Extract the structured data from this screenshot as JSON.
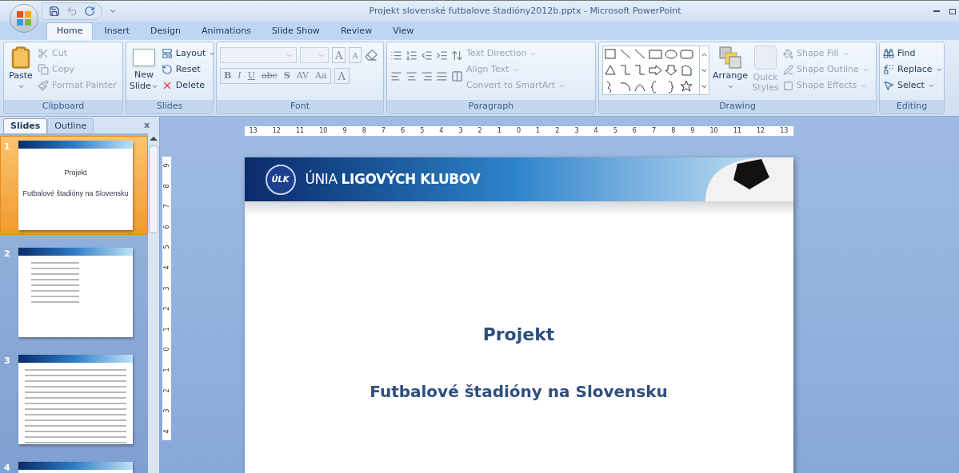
{
  "window": {
    "title": "Projekt slovenské futbalove štadióny2012b.pptx - Microsoft PowerPoint"
  },
  "tabs": [
    {
      "label": "Home",
      "selected": true
    },
    {
      "label": "Insert",
      "selected": false
    },
    {
      "label": "Design",
      "selected": false
    },
    {
      "label": "Animations",
      "selected": false
    },
    {
      "label": "Slide Show",
      "selected": false
    },
    {
      "label": "Review",
      "selected": false
    },
    {
      "label": "View",
      "selected": false
    }
  ],
  "clipboard": {
    "title": "Clipboard",
    "paste": {
      "label": "Paste",
      "disabled": false
    },
    "items": [
      {
        "label": "Cut",
        "disabled": true
      },
      {
        "label": "Copy",
        "disabled": true
      },
      {
        "label": "Format Painter",
        "disabled": true
      }
    ]
  },
  "slides_group": {
    "title": "Slides",
    "new_slide": [
      "New",
      "Slide"
    ],
    "items": [
      {
        "label": "Layout",
        "dropdown": true
      },
      {
        "label": "Reset",
        "dropdown": false
      },
      {
        "label": "Delete",
        "dropdown": false
      }
    ]
  },
  "font": {
    "title": "Font",
    "grow": "A",
    "shrink": "A",
    "format_buttons": [
      {
        "label": "B",
        "kind": "bold"
      },
      {
        "label": "I",
        "kind": "italic"
      },
      {
        "label": "U",
        "kind": "underline"
      },
      {
        "label": "abc",
        "kind": "strike"
      },
      {
        "label": "S",
        "kind": "shadow"
      },
      {
        "label": "AV",
        "kind": "spacing"
      },
      {
        "label": "Aa",
        "kind": "case"
      }
    ],
    "color_button": "A"
  },
  "paragraph": {
    "title": "Paragraph",
    "items": [
      {
        "label": "Text Direction",
        "disabled": true
      },
      {
        "label": "Align Text",
        "disabled": true
      },
      {
        "label": "Convert to SmartArt",
        "disabled": true
      }
    ]
  },
  "drawing": {
    "title": "Drawing",
    "arrange": "Arrange",
    "quick_styles": {
      "label": [
        "Quick",
        "Styles"
      ],
      "disabled": true
    },
    "items": [
      {
        "label": "Shape Fill",
        "disabled": true
      },
      {
        "label": "Shape Outline",
        "disabled": true
      },
      {
        "label": "Shape Effects",
        "disabled": true
      }
    ]
  },
  "editing": {
    "title": "Editing",
    "items": [
      {
        "label": "Find",
        "dropdown": false
      },
      {
        "label": "Replace",
        "dropdown": true
      },
      {
        "label": "Select",
        "dropdown": true
      }
    ]
  },
  "panel": {
    "tabs": [
      {
        "label": "Slides",
        "selected": true
      },
      {
        "label": "Outline",
        "selected": false
      }
    ],
    "close": "x",
    "thumbnails": [
      {
        "number": "1",
        "selected": true,
        "kind": "title",
        "lines": [
          "Projekt",
          "Futbalové štadióny na Slovensku"
        ]
      },
      {
        "number": "2",
        "selected": false,
        "kind": "list"
      },
      {
        "number": "3",
        "selected": false,
        "kind": "text"
      },
      {
        "number": "4",
        "selected": false,
        "kind": "partial"
      }
    ]
  },
  "ruler": {
    "horizontal": [
      "13",
      "12",
      "11",
      "10",
      "9",
      "8",
      "7",
      "6",
      "5",
      "4",
      "3",
      "2",
      "1",
      "0",
      "1",
      "2",
      "3",
      "4",
      "5",
      "6",
      "7",
      "8",
      "9",
      "10",
      "11",
      "12",
      "13"
    ],
    "vertical": [
      "9",
      "8",
      "7",
      "6",
      "5",
      "4",
      "3",
      "2",
      "1",
      "0",
      "1",
      "2",
      "3",
      "4"
    ]
  },
  "slide": {
    "logo": "ÚLK",
    "banner": "ÚNIA **LIGOVÝCH KLUBOV**",
    "title": "Projekt",
    "subtitle": "Futbalové štadióny na Slovensku"
  }
}
